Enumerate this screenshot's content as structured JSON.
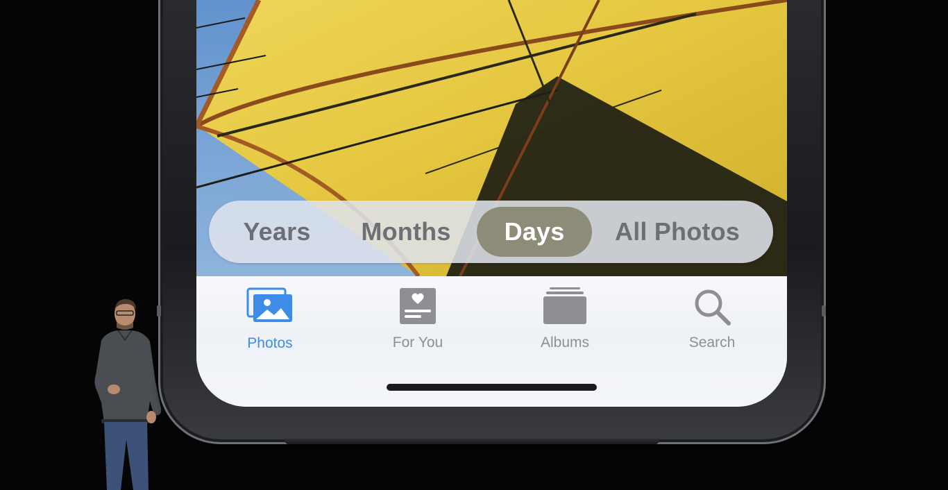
{
  "segmented_control": {
    "items": [
      {
        "label": "Years",
        "selected": false
      },
      {
        "label": "Months",
        "selected": false
      },
      {
        "label": "Days",
        "selected": true
      },
      {
        "label": "All Photos",
        "selected": false
      }
    ]
  },
  "tab_bar": {
    "tabs": [
      {
        "label": "Photos",
        "icon": "photos-icon",
        "selected": true
      },
      {
        "label": "For You",
        "icon": "for-you-icon",
        "selected": false
      },
      {
        "label": "Albums",
        "icon": "albums-icon",
        "selected": false
      },
      {
        "label": "Search",
        "icon": "search-icon",
        "selected": false
      }
    ]
  },
  "colors": {
    "accent": "#3f8be8",
    "segment_selected": "#8c8c78",
    "inactive_label": "#8e8e93"
  }
}
